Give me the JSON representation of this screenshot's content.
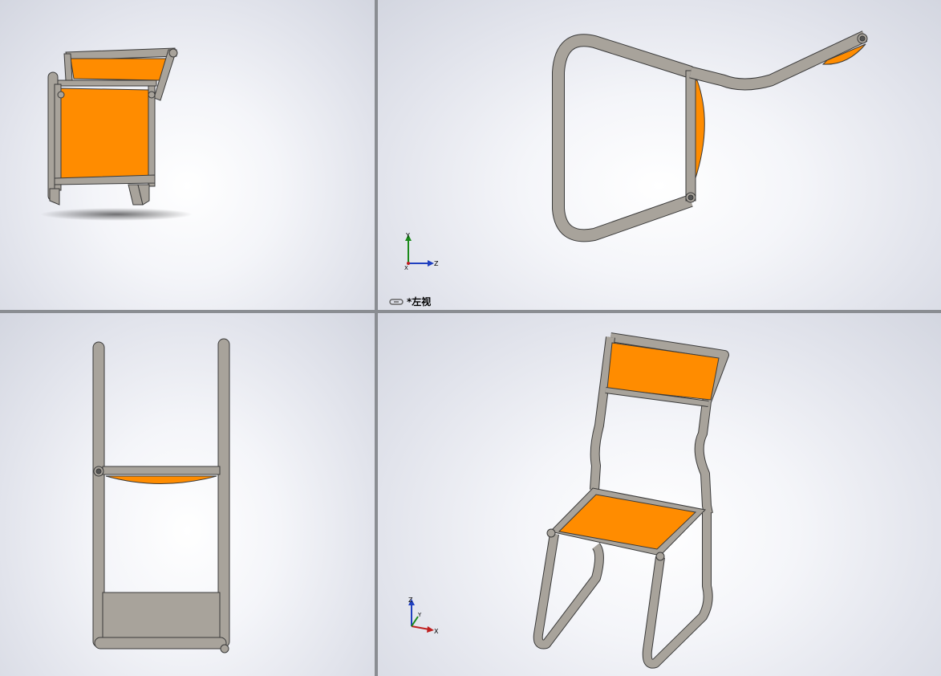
{
  "viewports": [
    {
      "id": "top-left",
      "label": ""
    },
    {
      "id": "top-right",
      "label": "*左视",
      "triad": {
        "axes": [
          "Y",
          "X",
          "Z"
        ]
      }
    },
    {
      "id": "bottom-left",
      "label": ""
    },
    {
      "id": "bottom-right",
      "label": "",
      "triad": {
        "axes": [
          "Z",
          "Y",
          "X"
        ]
      }
    }
  ],
  "colors": {
    "frame": "#a8a39b",
    "frame_edge": "#3a3a3a",
    "panel": "#ff8c00",
    "background": "#eef0f6",
    "divider": "#8a8d92"
  },
  "icons": [
    "link-icon",
    "coordinate-triad-icon"
  ]
}
